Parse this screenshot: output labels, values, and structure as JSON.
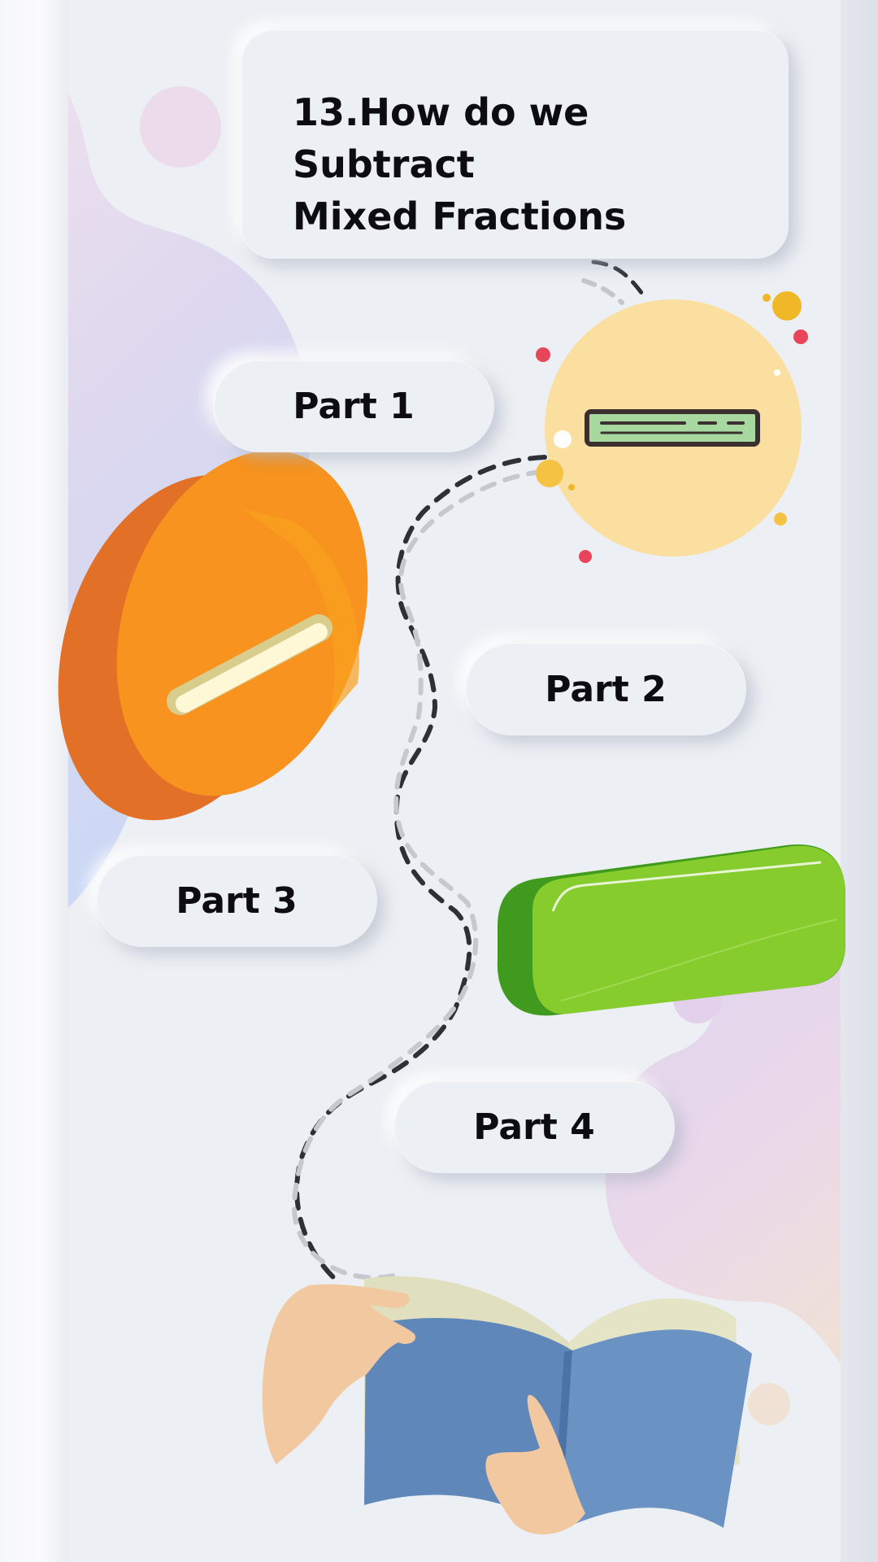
{
  "title": {
    "line1": "13.How do we Subtract",
    "line2": "Mixed Fractions"
  },
  "parts": [
    {
      "label": "Part 1"
    },
    {
      "label": "Part 2"
    },
    {
      "label": "Part 3"
    },
    {
      "label": "Part 4"
    }
  ],
  "icons": {
    "fraction_bar": "fraction-bar-icon",
    "minus_disc": "orange-minus-disc",
    "green_bar": "green-bar-illustration",
    "book": "open-book-illustration"
  },
  "colors": {
    "background": "#eceff3",
    "text": "#0c0c12",
    "orange": "#f28a1e",
    "green": "#6cc02a",
    "circle": "#fbdfa0",
    "book_blue": "#5f87b9"
  }
}
